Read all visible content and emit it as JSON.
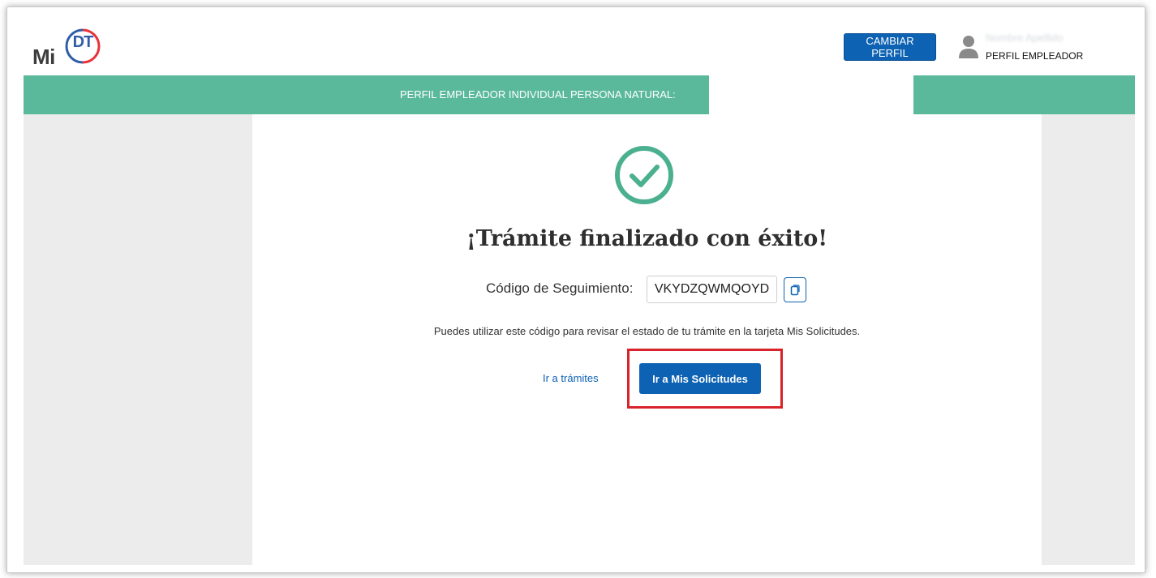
{
  "header": {
    "logo": {
      "mi": "Mi",
      "dt": "DT"
    },
    "change_profile_label": "CAMBIAR PERFIL",
    "user": {
      "name": "Nombre Apellido",
      "profile": "PERFIL EMPLEADOR",
      "icon": "user-icon"
    }
  },
  "banner": {
    "text": "PERFIL EMPLEADOR INDIVIDUAL PERSONA NATURAL:"
  },
  "result": {
    "icon": "check-circle-icon",
    "title": "¡Trámite finalizado con éxito!",
    "code_label": "Código de Seguimiento:",
    "code_value": "VKYDZQWMQOYD",
    "copy_icon": "copy-icon",
    "description": "Puedes utilizar este código para revisar el estado de tu trámite en la tarjeta Mis Solicitudes.",
    "link_tramites": "Ir a trámites",
    "button_solicitudes": "Ir a Mis Solicitudes"
  },
  "colors": {
    "primary": "#0d62b3",
    "banner": "#5bb99b",
    "success": "#4bb08f",
    "highlight": "#d9232a",
    "logo_blue": "#2f5da8",
    "logo_red": "#e8333b"
  }
}
